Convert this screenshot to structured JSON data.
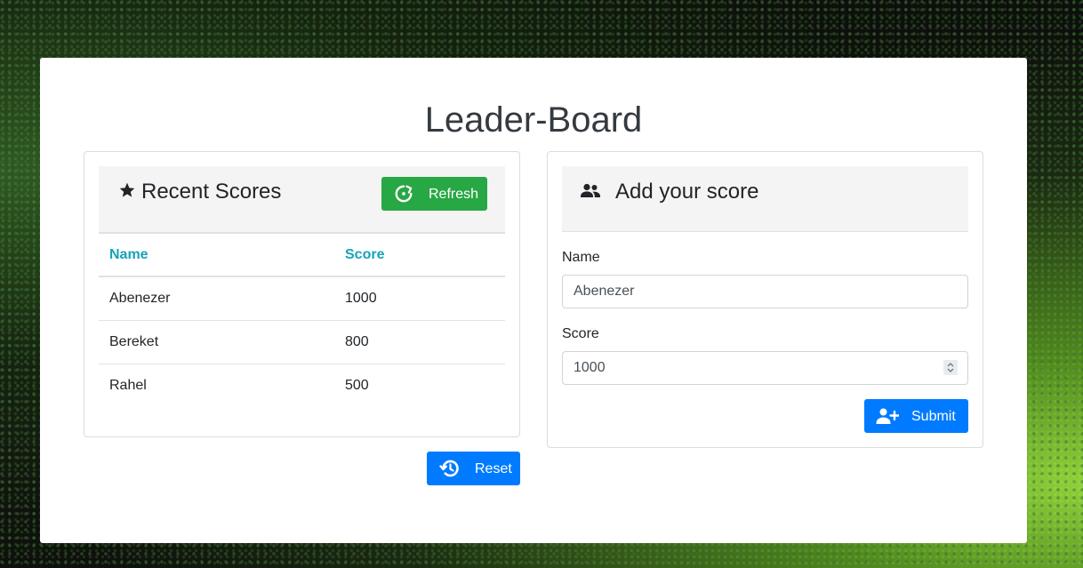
{
  "page": {
    "title": "Leader-Board"
  },
  "recent_scores": {
    "header": "Recent Scores",
    "refresh_label": "Refresh",
    "columns": [
      "Name",
      "Score"
    ],
    "rows": [
      {
        "name": "Abenezer",
        "score": "1000"
      },
      {
        "name": "Bereket",
        "score": "800"
      },
      {
        "name": "Rahel",
        "score": "500"
      }
    ],
    "reset_label": "Reset"
  },
  "add_score": {
    "header": "Add your score",
    "name_label": "Name",
    "name_value": "Abenezer",
    "score_label": "Score",
    "score_value": "1000",
    "submit_label": "Submit"
  },
  "colors": {
    "refresh_button": "#28a745",
    "primary_button": "#007bff",
    "table_header": "#17a2b8"
  },
  "icons": {
    "recent_scores": "star-icon",
    "refresh": "refresh-icon",
    "add_score": "users-icon",
    "submit": "user-plus-icon",
    "reset": "history-icon"
  }
}
